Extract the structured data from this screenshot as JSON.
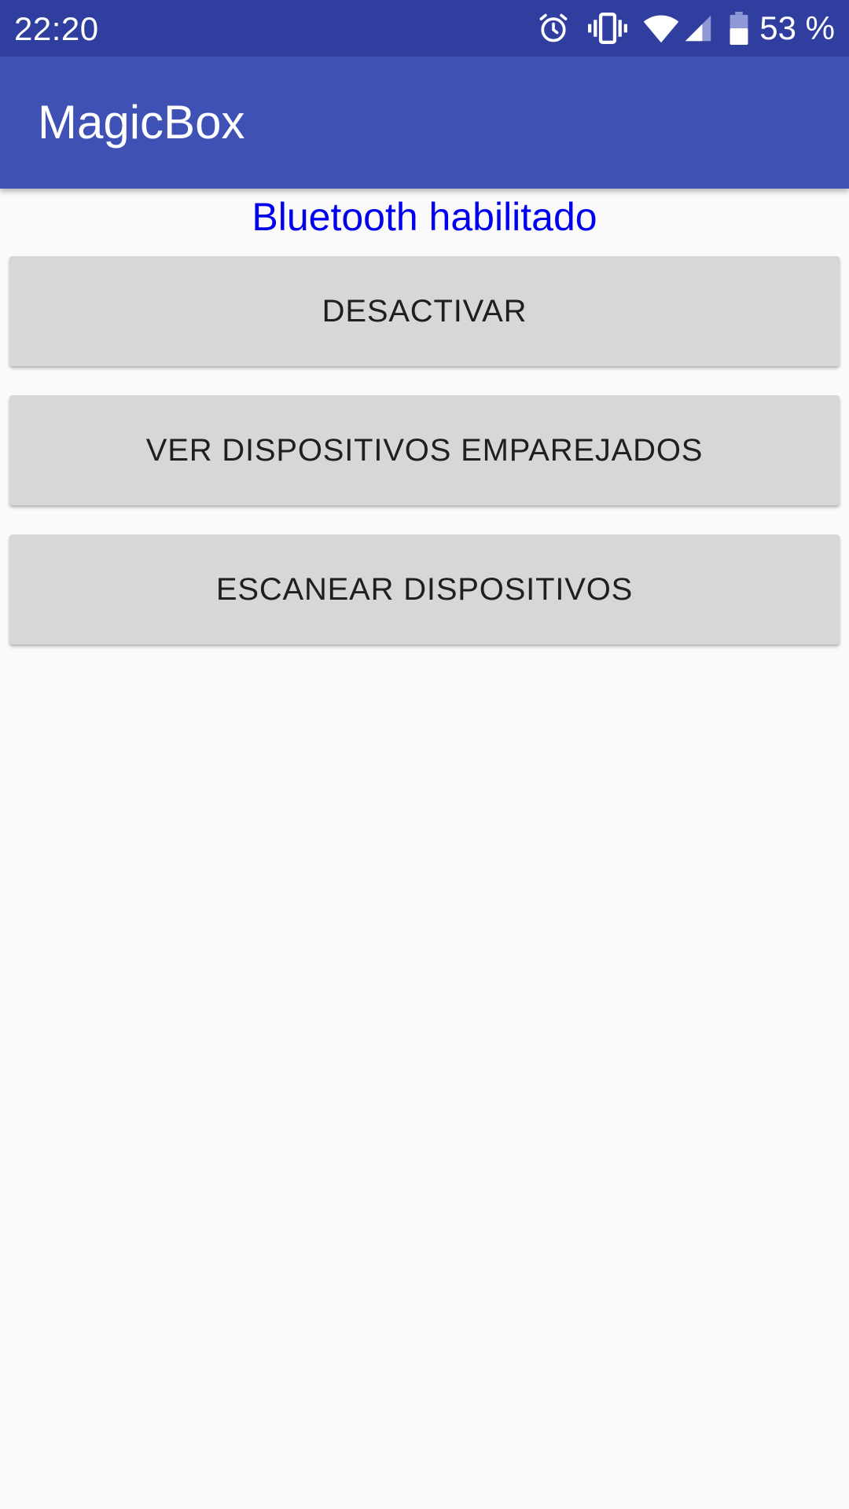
{
  "status_bar": {
    "time": "22:20",
    "battery_text": "53 %",
    "icons": [
      "alarm-icon",
      "vibrate-icon",
      "wifi-icon",
      "cell-signal-icon",
      "battery-icon"
    ],
    "background_color": "#303f9f"
  },
  "app_bar": {
    "title": "MagicBox",
    "background_color": "#3f51b5"
  },
  "main": {
    "bluetooth_status": "Bluetooth habilitado",
    "bluetooth_status_color": "#0000ee",
    "buttons": [
      {
        "label": "DESACTIVAR"
      },
      {
        "label": "VER DISPOSITIVOS EMPAREJADOS"
      },
      {
        "label": "ESCANEAR DISPOSITIVOS"
      }
    ]
  }
}
